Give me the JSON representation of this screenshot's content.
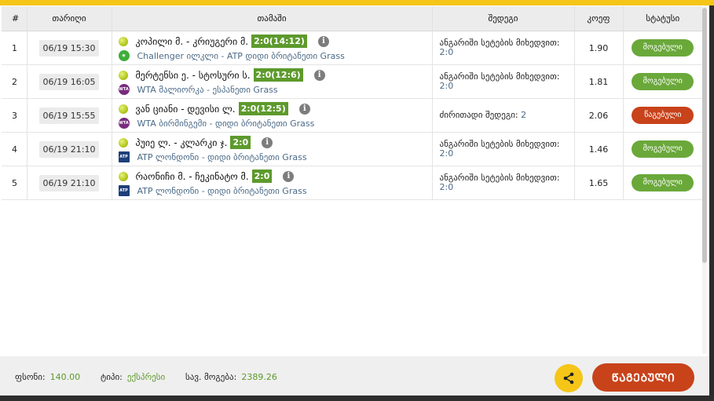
{
  "header": {
    "num": "#",
    "date": "თარიღი",
    "match": "თამაში",
    "result": "შედეგი",
    "odds": "კოეფ",
    "status": "სტატუსი"
  },
  "rows": [
    {
      "num": "1",
      "date": "06/19 15:30",
      "match": "კოპილი მ. - კრიუგერი მ.",
      "score": "2:0(14:12)",
      "tournament": "Challenger ილკლი - ATP დიდი ბრიტანეთი Grass",
      "tournament_logo": "challenger-logo",
      "result_label": "ანგარიში სეტების მიხედვით:",
      "result_value": "2:0",
      "odds": "1.90",
      "status": "მოგებული",
      "status_type": "won"
    },
    {
      "num": "2",
      "date": "06/19 16:05",
      "match": "მერტენსი ე. - სტოსური ს.",
      "score": "2:0(12:6)",
      "tournament": "WTA მალიორკა - ესპანეთი Grass",
      "tournament_logo": "wta-logo",
      "result_label": "ანგარიში სეტების მიხედვით:",
      "result_value": "2:0",
      "odds": "1.81",
      "status": "მოგებული",
      "status_type": "won"
    },
    {
      "num": "3",
      "date": "06/19 15:55",
      "match": "ვან ციანი - დევისი ლ.",
      "score": "2:0(12:5)",
      "tournament": "WTA ბირმინგემი - დიდი ბრიტანეთი Grass",
      "tournament_logo": "wta-logo",
      "result_label": "ძირითადი შედეგი:",
      "result_value": "2",
      "odds": "2.06",
      "status": "წაგებული",
      "status_type": "lost"
    },
    {
      "num": "4",
      "date": "06/19 21:10",
      "match": "პუიე ლ. - კლარკი ჯ.",
      "score": "2:0",
      "tournament": "ATP ლონდონი - დიდი ბრიტანეთი Grass",
      "tournament_logo": "atp-logo",
      "result_label": "ანგარიში სეტების მიხედვით:",
      "result_value": "2:0",
      "odds": "1.46",
      "status": "მოგებული",
      "status_type": "won"
    },
    {
      "num": "5",
      "date": "06/19 21:10",
      "match": "რაონიჩი მ. - ჩეკინატო მ.",
      "score": "2:0",
      "tournament": "ATP ლონდონი - დიდი ბრიტანეთი Grass",
      "tournament_logo": "atp-logo",
      "result_label": "ანგარიში სეტების მიხედვით:",
      "result_value": "2:0",
      "odds": "1.65",
      "status": "მოგებული",
      "status_type": "won"
    }
  ],
  "footer": {
    "stake_label": "ფსონი:",
    "stake_value": "140.00",
    "type_label": "ტიპი:",
    "type_value": "ექსპრესი",
    "payout_label": "სავ. მოგება:",
    "payout_value": "2389.26",
    "final_status": "ᲬᲐᲒᲔᲑᲣᲚᲘ"
  },
  "colors": {
    "accent": "#f5c518",
    "won": "#6aa83a",
    "lost": "#c8421a",
    "score_bg": "#5d9a2c",
    "link": "#4b6a87"
  }
}
